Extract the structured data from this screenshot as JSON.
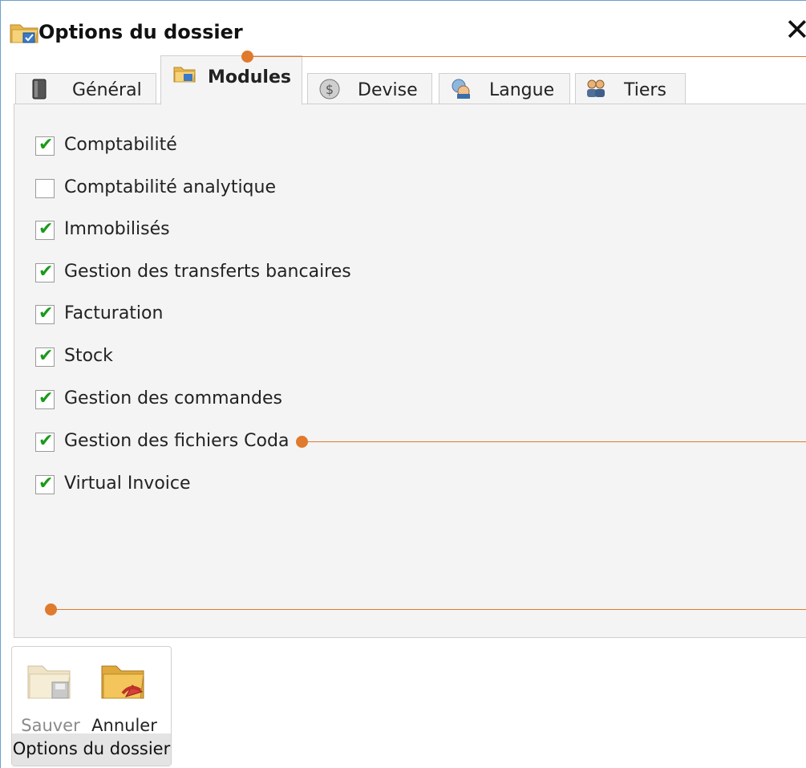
{
  "window": {
    "title": "Options du dossier",
    "close_label": "✕"
  },
  "tabs": [
    {
      "label": "Général",
      "icon": "book-icon",
      "active": false
    },
    {
      "label": "Modules",
      "icon": "folder-modules-icon",
      "active": true
    },
    {
      "label": "Devise",
      "icon": "currency-icon",
      "active": false
    },
    {
      "label": "Langue",
      "icon": "language-icon",
      "active": false
    },
    {
      "label": "Tiers",
      "icon": "users-icon",
      "active": false
    }
  ],
  "modules": [
    {
      "label": "Comptabilité",
      "checked": true
    },
    {
      "label": "Comptabilité analytique",
      "checked": false
    },
    {
      "label": "Immobilisés",
      "checked": true
    },
    {
      "label": "Gestion des transferts bancaires",
      "checked": true
    },
    {
      "label": "Facturation",
      "checked": true
    },
    {
      "label": "Stock",
      "checked": true
    },
    {
      "label": "Gestion des commandes",
      "checked": true
    },
    {
      "label": "Gestion des fichiers Coda",
      "checked": true
    },
    {
      "label": "Virtual Invoice",
      "checked": true
    }
  ],
  "check_glyph": "✔",
  "ribbon": {
    "save_label": "Sauver",
    "cancel_label": "Annuler",
    "group_label": "Options du dossier"
  },
  "colors": {
    "annotation": "#e07a2c",
    "check": "#1a9a1a",
    "panel_bg": "#f4f4f4"
  }
}
